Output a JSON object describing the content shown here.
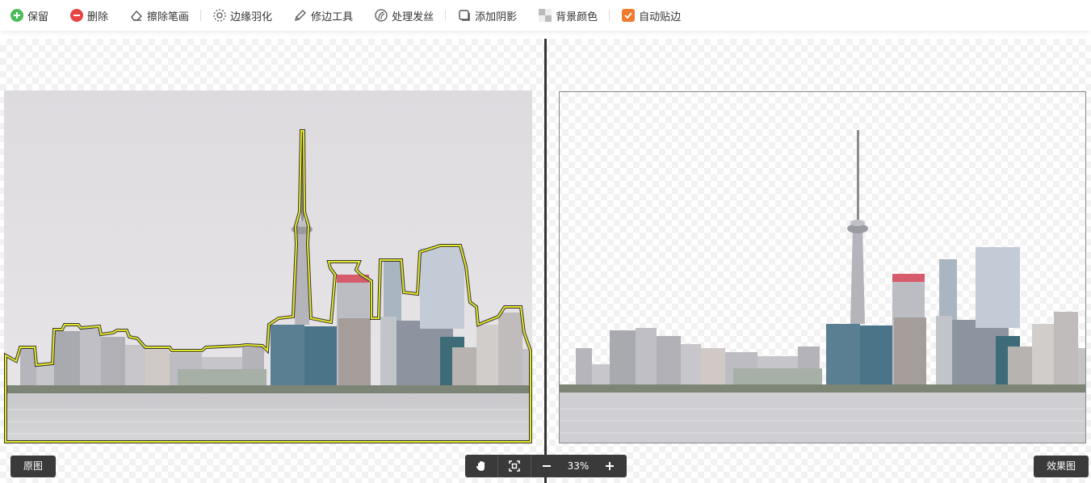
{
  "toolbar": {
    "items": [
      {
        "label": "保留",
        "icon": "plus-circle-icon"
      },
      {
        "label": "删除",
        "icon": "minus-circle-icon"
      },
      {
        "label": "擦除笔画",
        "icon": "eraser-icon"
      },
      {
        "label": "边缘羽化",
        "icon": "feather-gear-icon"
      },
      {
        "label": "修边工具",
        "icon": "pen-icon"
      },
      {
        "label": "处理发丝",
        "icon": "hair-icon"
      },
      {
        "label": "添加阴影",
        "icon": "shadow-square-icon"
      },
      {
        "label": "背景颜色",
        "icon": "background-color-icon"
      },
      {
        "label": "自动贴边",
        "icon": "checkbox-checked-icon"
      }
    ]
  },
  "labels": {
    "original": "原图",
    "result": "效果图"
  },
  "zoom": {
    "level": "33%"
  },
  "colors": {
    "keep": "#4cbb5a",
    "delete": "#e84444",
    "checkbox": "#f07a2e",
    "outline": "#e6e82a"
  }
}
